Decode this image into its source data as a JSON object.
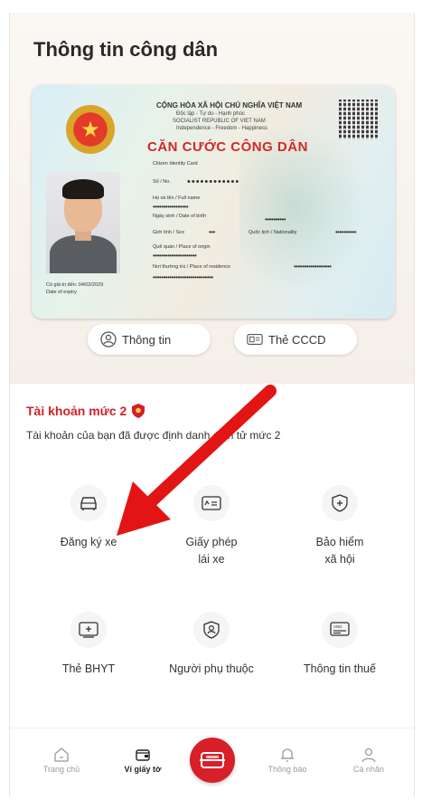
{
  "page_title": "Thông tin công dân",
  "card": {
    "country_line": "CỘNG HÒA XÃ HỘI CHỦ NGHĨA VIỆT NAM",
    "motto_line": "Độc lập - Tự do - Hạnh phúc",
    "country_en": "SOCIALIST REPUBLIC OF VIET NAM",
    "motto_en": "Independence - Freedom - Happiness",
    "title": "CĂN CƯỚC CÔNG DÂN",
    "subtitle": "Citizen Identity Card",
    "no_label": "Số / No.",
    "no_value": "••••••••••••",
    "name_label": "Họ và tên / Full name",
    "name_value": "•••••••••••••••••",
    "dob_label": "Ngày sinh / Date of birth",
    "dob_value": "••••••••••",
    "sex_label": "Giới tính / Sex",
    "sex_value": "•••",
    "nationality_label": "Quốc tịch / Nationality",
    "nationality_value": "••••••••••",
    "origin_label": "Quê quán / Place of origin",
    "origin_value": "•••••••••••••••••••••",
    "residence_label": "Nơi thường trú / Place of residence",
    "residence_value": "••••••••••••••••••",
    "residence_value2": "•••••••••••••••••••••••••••••",
    "expiry": "Có giá trị đến: 04/02/2029",
    "expiry2": "Date of expiry"
  },
  "pills": {
    "info_label": "Thông tin",
    "card_label": "Thẻ CCCD"
  },
  "account": {
    "title": "Tài khoản mức 2",
    "desc": "Tài khoản của bạn đã được định danh điện tử mức 2"
  },
  "services": [
    {
      "label": "Đăng ký xe",
      "icon": "car-icon"
    },
    {
      "label": "Giấy phép\nlái xe",
      "icon": "license-icon"
    },
    {
      "label": "Bảo hiểm\nxã hội",
      "icon": "shield-plus-icon"
    },
    {
      "label": "Thẻ BHYT",
      "icon": "health-card-icon"
    },
    {
      "label": "Người phụ thuộc",
      "icon": "person-icon"
    },
    {
      "label": "Thông tin thuế",
      "icon": "tax-icon"
    }
  ],
  "tabs": {
    "home": "Trang chủ",
    "wallet": "Ví giấy tờ",
    "notify": "Thông báo",
    "profile": "Cá nhân"
  },
  "colors": {
    "accent": "#d1202a",
    "arrow": "#e31414"
  }
}
